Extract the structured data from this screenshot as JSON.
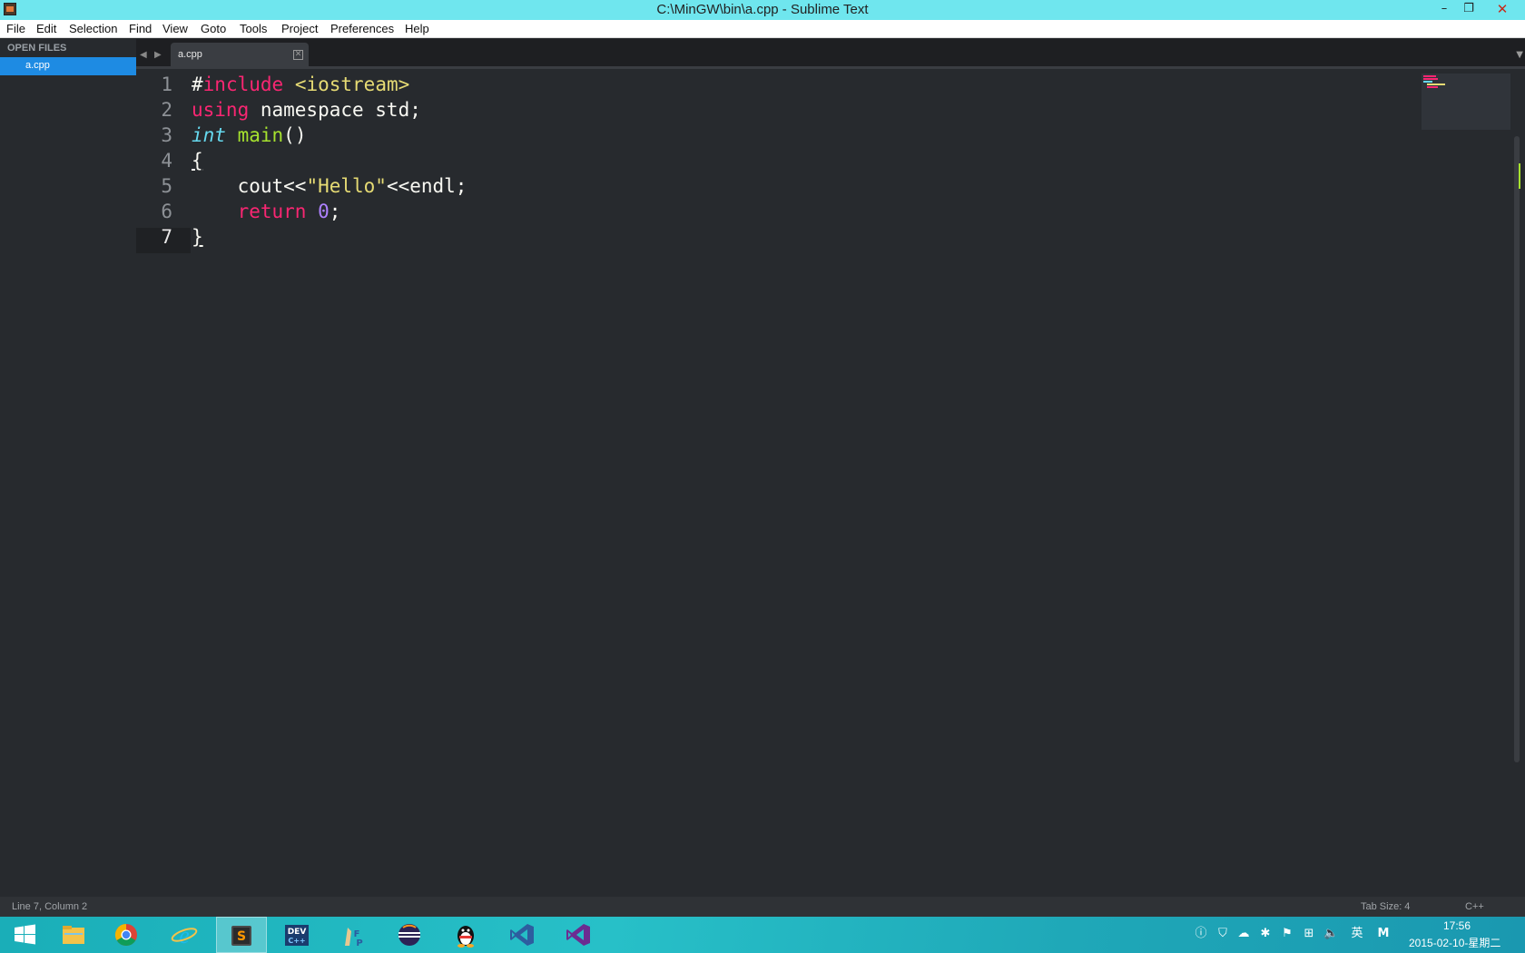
{
  "window": {
    "title": "C:\\MinGW\\bin\\a.cpp - Sublime Text",
    "minimize": "–",
    "maximize": "❐",
    "close": "✕"
  },
  "menu": [
    "File",
    "Edit",
    "Selection",
    "Find",
    "View",
    "Goto",
    "Tools",
    "Project",
    "Preferences",
    "Help"
  ],
  "sidebar": {
    "heading": "OPEN FILES",
    "files": [
      "a.cpp"
    ]
  },
  "tabs": [
    {
      "label": "a.cpp",
      "close": "✕"
    }
  ],
  "editor": {
    "line_numbers": [
      "1",
      "2",
      "3",
      "4",
      "5",
      "6",
      "7"
    ],
    "current_line": 7,
    "lines": {
      "l1": {
        "hash": "#",
        "kw": "include",
        "space": " ",
        "header": "<iostream>"
      },
      "l2": {
        "kw": "using",
        "rest": " namespace std;"
      },
      "l3": {
        "type": "int",
        "space": " ",
        "fn": "main",
        "rest": "()"
      },
      "l4": {
        "text": "{"
      },
      "l5": {
        "indent": "    ",
        "pre": "cout<<",
        "str": "\"Hello\"",
        "post": "<<endl;"
      },
      "l6": {
        "indent": "    ",
        "kw": "return",
        "space": " ",
        "num": "0",
        "post": ";"
      },
      "l7": {
        "text": "}"
      }
    }
  },
  "status": {
    "position": "Line 7, Column 2",
    "tab_size": "Tab Size: 4",
    "syntax": "C++"
  },
  "taskbar": {
    "apps": [
      "windows-start",
      "file-explorer",
      "chrome",
      "internet-explorer",
      "sublime-text",
      "dev-cpp",
      "free-pascal",
      "eclipse",
      "qq",
      "visual-studio",
      "visual-studio-alt"
    ],
    "tray_ime": "英",
    "tray_m": "M",
    "time": "17:56",
    "date": "2015-02-10-星期二"
  },
  "colors": {
    "keyword": "#f92672",
    "string": "#e6db74",
    "function": "#a6e22e",
    "type": "#66d9ef",
    "number": "#ae81ff",
    "selection": "#1e8be3"
  }
}
